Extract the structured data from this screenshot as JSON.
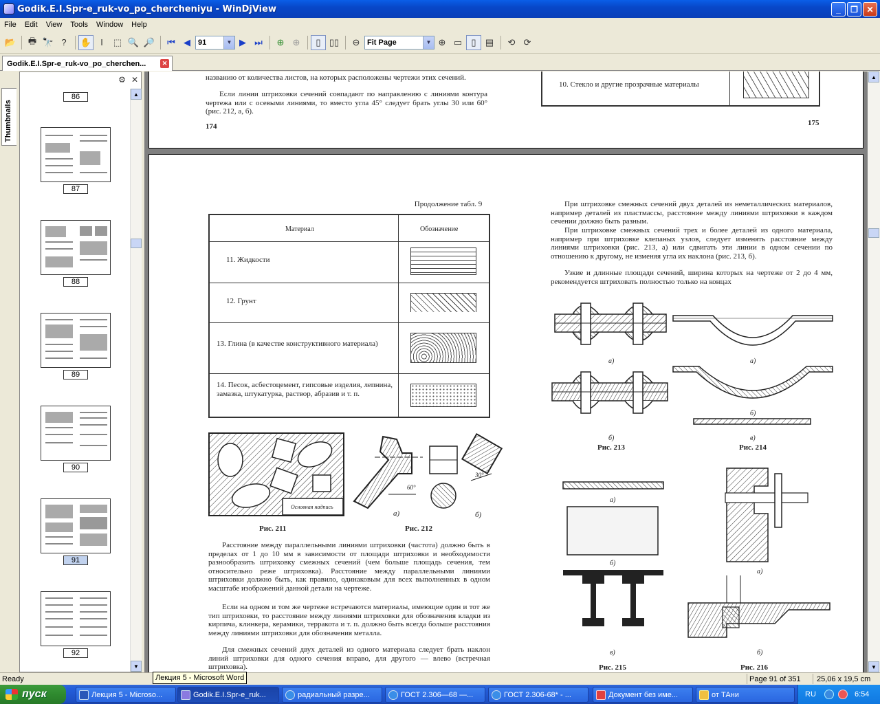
{
  "window": {
    "title": "Godik.E.I.Spr-e_ruk-vo_po_chercheniyu - WinDjView"
  },
  "menu": [
    "File",
    "Edit",
    "View",
    "Tools",
    "Window",
    "Help"
  ],
  "toolbar": {
    "page_number": "91",
    "zoom": "Fit Page"
  },
  "tab": {
    "label": "Godik.E.I.Spr-e_ruk-vo_po_cherchen..."
  },
  "sidebar": {
    "tab_label": "Thumbnails",
    "thumbnails": [
      {
        "page": "86"
      },
      {
        "page": "87"
      },
      {
        "page": "88"
      },
      {
        "page": "89"
      },
      {
        "page": "90"
      },
      {
        "page": "91",
        "selected": true
      },
      {
        "page": "92"
      }
    ]
  },
  "top_page": {
    "left_text1": "названию от количества листов, на которых расположены чертежи этих сечений.",
    "left_text2": "Если линии штриховки сечений совпадают по направлению с линиями контура чертежа или с осевыми линиями, то вместо угла 45° следует брать углы 30 или 60° (рис. 212, а, б).",
    "left_page_num": "174",
    "row10": "10. Стекло и другие прозрачные материалы",
    "right_page_num": "175"
  },
  "main_page": {
    "table_caption": "Продолжение табл. 9",
    "col_material": "Материал",
    "col_designation": "Обозначение",
    "rows": [
      {
        "label": "11. Жидкости"
      },
      {
        "label": "12. Грунт"
      },
      {
        "label": "13. Глина (в качестве конструктивного материала)"
      },
      {
        "label": "14. Песок, асбестоцемент, гипсовые изделия, лепнина, замазка, штукатурка, раствор, абразив и т. п."
      }
    ],
    "fig211_label": "Основная надпись",
    "fig211": "Рис. 211",
    "fig212": "Рис. 212",
    "fig212_a": "а)",
    "fig212_b": "б)",
    "fig212_angle1": "60°",
    "fig212_angle2": "30°",
    "left_para1": "Расстояние между параллельными линиями штриховки (частота) должно быть в пределах от 1 до 10 мм в зависимости от площади штриховки и необходимости разнообразить штриховку смежных сечений (чем больше площадь сечения, тем относительно реже штриховка). Расстояние между параллельными линиями штриховки должно быть, как правило, одинаковым для всех выполненных в одном масштабе изображений данной детали на чертеже.",
    "left_para2": "Если на одном и том же чертеже встречаются материалы, имеющие один и тот же тип штриховки, то расстояние между линиями штриховки для обозначения кладки из кирпича, клинкера, керамики, терракота и т. п. должно быть всегда больше расстояния между линиями штриховки для обозначения металла.",
    "left_para3": "Для смежных сечений двух деталей из одного материала следует брать наклон линий штриховки для одного сечения вправо, для другого — влево (встречная штриховка).",
    "right_para1": "При штриховке смежных сечений двух деталей из неметаллических материалов, например деталей из пластмассы, расстояние между линиями штриховки в каждом сечении должно быть разным.",
    "right_para2": "При штриховке смежных сечений трех и более деталей из одного материала, например при штриховке клепаных узлов, следует изменять расстояние между линиями штриховки (рис. 213, а) или сдвигать эти линии в одном сечении по отношению к другому, не изменяя угла их наклона (рис. 213, б).",
    "right_para3": "Узкие и длинные площади сечений, ширина которых на чертеже от 2 до 4 мм, рекомендуется штриховать полностью только на концах",
    "fig213": "Рис. 213",
    "fig214": "Рис. 214",
    "fig215": "Рис. 215",
    "fig216": "Рис. 216",
    "sub_a": "а)",
    "sub_b": "б)",
    "sub_v": "в)"
  },
  "status": {
    "ready": "Ready",
    "tooltip": "Лекция 5 - Microsoft Word",
    "page_info": "Page 91 of 351",
    "size_info": "25,06 x 19,5 cm"
  },
  "taskbar": {
    "start": "пуск",
    "tasks": [
      {
        "label": "Лекция 5 - Microso...",
        "color": "#2b57b8"
      },
      {
        "label": "Godik.E.I.Spr-e_ruk...",
        "color": "#8a7ae0",
        "active": true
      },
      {
        "label": "радиальный разре...",
        "color": "#3a8ee8"
      },
      {
        "label": "ГОСТ 2.306—68 —...",
        "color": "#3a8ee8"
      },
      {
        "label": "ГОСТ 2.306-68* - ...",
        "color": "#3a8ee8"
      },
      {
        "label": "Документ без име...",
        "color": "#e04040"
      },
      {
        "label": "от ТАни",
        "color": "#f0c040"
      }
    ],
    "lang": "RU",
    "clock": "6:54"
  }
}
